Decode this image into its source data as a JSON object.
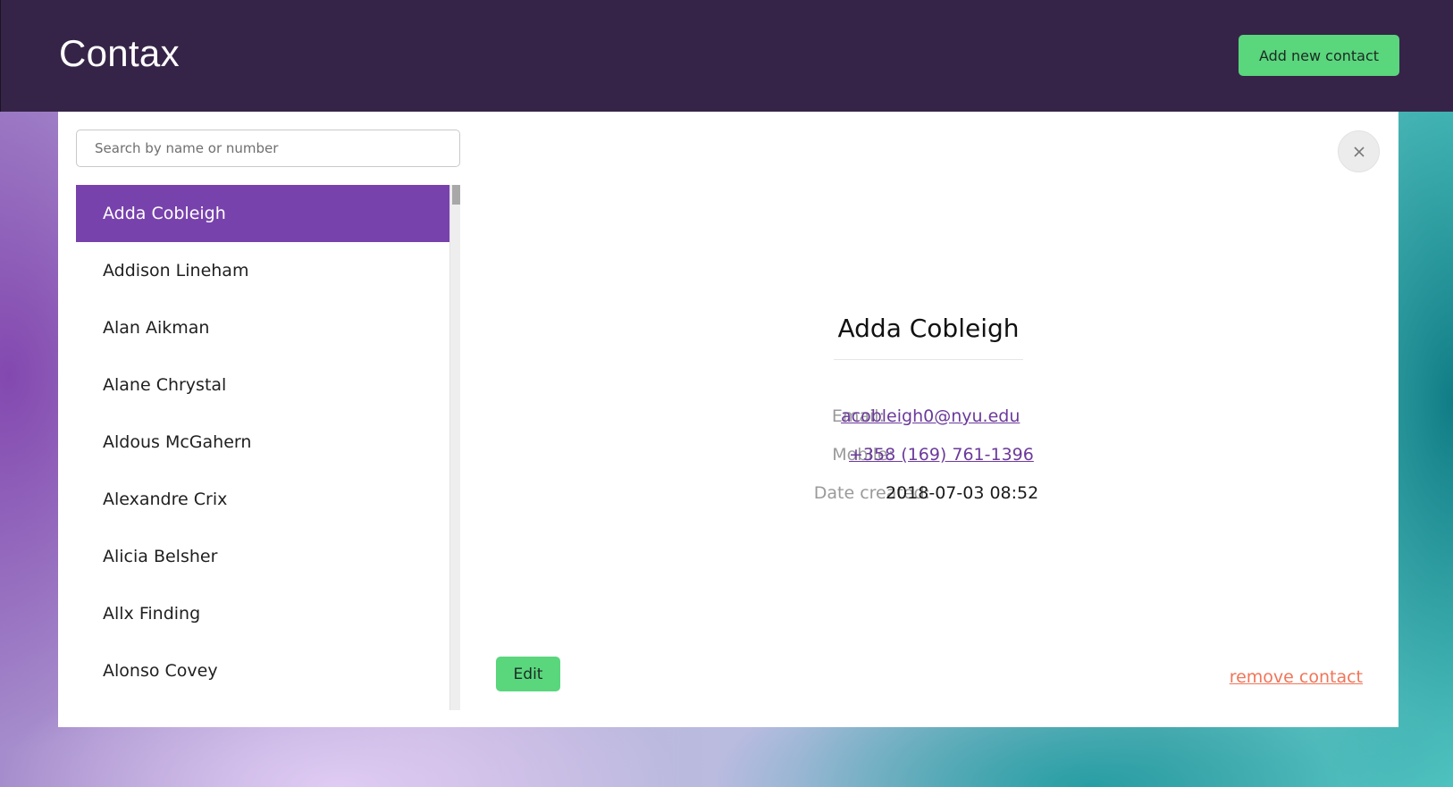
{
  "header": {
    "app_title": "Contax",
    "add_button_label": "Add new contact"
  },
  "search": {
    "placeholder": "Search by name or number",
    "value": ""
  },
  "contacts": {
    "selected_index": 0,
    "items": [
      {
        "name": "Adda Cobleigh"
      },
      {
        "name": "Addison Lineham"
      },
      {
        "name": "Alan Aikman"
      },
      {
        "name": "Alane Chrystal"
      },
      {
        "name": "Aldous McGahern"
      },
      {
        "name": "Alexandre Crix"
      },
      {
        "name": "Alicia Belsher"
      },
      {
        "name": "Allx Finding"
      },
      {
        "name": "Alonso Covey"
      }
    ]
  },
  "detail": {
    "name": "Adda Cobleigh",
    "email_label": "Email:",
    "email": "acobleigh0@nyu.edu",
    "mobile_label": "Mobile:",
    "mobile": "+358 (169) 761-1396",
    "date_label": "Date created:",
    "date": "2018-07-03 08:52",
    "edit_label": "Edit",
    "remove_label": "remove contact"
  },
  "icons": {
    "close": "close-icon"
  },
  "colors": {
    "header_bg": "#362448",
    "accent_green": "#5ad67d",
    "selected_purple": "#7842ad",
    "link_purple": "#6b3a9b",
    "remove_red": "#f07559"
  }
}
